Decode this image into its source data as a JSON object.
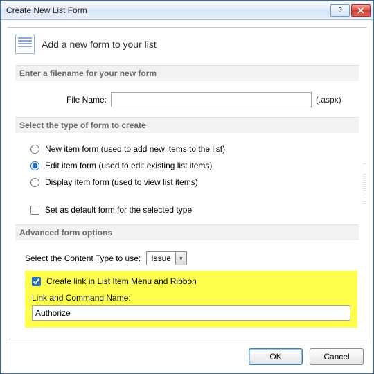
{
  "title": "Create New List Form",
  "header": "Add a new form to your list",
  "sections": {
    "filename": {
      "header": "Enter a filename for your new form",
      "label": "File Name:",
      "value": "",
      "suffix": "(.aspx)"
    },
    "formtype": {
      "header": "Select the type of form to create",
      "options": {
        "new": "New item form (used to add new items to the list)",
        "edit": "Edit item form (used to edit existing list items)",
        "display": "Display item form (used to view list items)"
      },
      "selected": "edit",
      "default_checkbox": "Set as default form for the selected type"
    },
    "advanced": {
      "header": "Advanced form options",
      "content_type_label": "Select the Content Type to use:",
      "content_type_value": "Issue",
      "create_link_label": "Create link in List Item Menu and Ribbon",
      "link_name_label": "Link and Command Name:",
      "link_name_value": "Authorize"
    }
  },
  "buttons": {
    "ok": "OK",
    "cancel": "Cancel"
  },
  "icons": {
    "help": "?",
    "close": "✕",
    "dropdown": "▾"
  }
}
